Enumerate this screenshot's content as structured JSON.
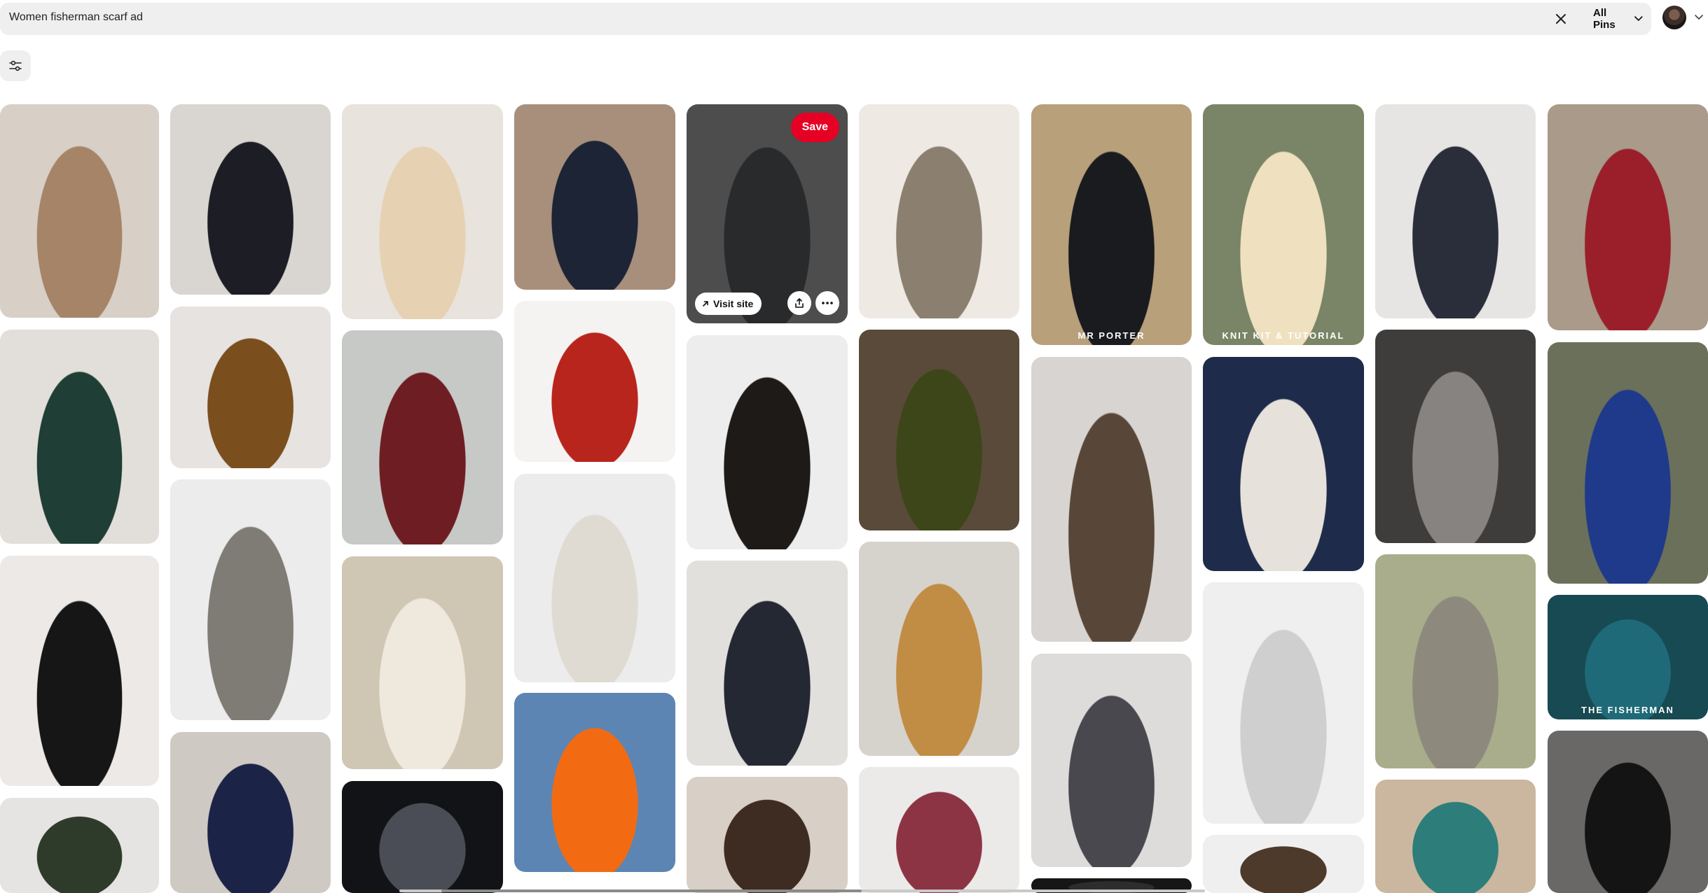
{
  "search": {
    "query": "Women fisherman scarf ad",
    "scope_label": "All Pins"
  },
  "pins": [
    {
      "id": "p01",
      "colors": [
        "#d8cfc6",
        "#a58468"
      ]
    },
    {
      "id": "p02",
      "colors": [
        "#d9d5d0",
        "#1d1e25"
      ]
    },
    {
      "id": "p03",
      "colors": [
        "#e8e3dc",
        "#e6d2b2"
      ]
    },
    {
      "id": "p04",
      "colors": [
        "#a78f7c",
        "#1c2435"
      ]
    },
    {
      "id": "p05",
      "colors": [
        "#6b6b6b",
        "#3a3b3d"
      ],
      "hovered": true
    },
    {
      "id": "p06",
      "colors": [
        "#eee9e3",
        "#8b7f70"
      ]
    },
    {
      "id": "p07",
      "colors": [
        "#b7a07a",
        "#1a1b1f"
      ],
      "caption": "MR PORTER"
    },
    {
      "id": "p08",
      "colors": [
        "#7a8466",
        "#efe1bf"
      ],
      "caption": "KNIT KIT & TUTORIAL"
    },
    {
      "id": "p09",
      "colors": [
        "#e7e5e3",
        "#2a2e3a"
      ]
    },
    {
      "id": "p10",
      "colors": [
        "#a99a8a",
        "#9a1f2a"
      ]
    },
    {
      "id": "p11",
      "colors": [
        "#e2dfda",
        "#1f3e35"
      ]
    },
    {
      "id": "p12",
      "colors": [
        "#e6e3e0",
        "#7b4e1e"
      ]
    },
    {
      "id": "p13",
      "colors": [
        "#c7c9c7",
        "#6e1e22"
      ]
    },
    {
      "id": "p14",
      "colors": [
        "#f5f3f1",
        "#b7251d"
      ]
    },
    {
      "id": "p15",
      "colors": [
        "#ededed",
        "#1d1a18"
      ]
    },
    {
      "id": "p16",
      "colors": [
        "#5a4a3a",
        "#3d4618"
      ]
    },
    {
      "id": "p17",
      "colors": [
        "#d7d4d1",
        "#584738"
      ]
    },
    {
      "id": "p18",
      "colors": [
        "#1f2b4a",
        "#e6e1da"
      ]
    },
    {
      "id": "p19",
      "colors": [
        "#3f3d3b",
        "#878380"
      ]
    },
    {
      "id": "p20",
      "colors": [
        "#6b705a",
        "#1f3a8a"
      ]
    },
    {
      "id": "p21",
      "colors": [
        "#ece9e6",
        "#161616"
      ]
    },
    {
      "id": "p22",
      "colors": [
        "#ececec",
        "#7f7b75"
      ]
    },
    {
      "id": "p23",
      "colors": [
        "#d0c6b4",
        "#efe8dc"
      ]
    },
    {
      "id": "p24",
      "colors": [
        "#ececec",
        "#e0dbd2"
      ]
    },
    {
      "id": "p25",
      "colors": [
        "#e2e0dd",
        "#232833"
      ]
    },
    {
      "id": "p26",
      "colors": [
        "#d6d3cc",
        "#c18c43"
      ]
    },
    {
      "id": "p27",
      "colors": [
        "#dedcda",
        "#48484e"
      ]
    },
    {
      "id": "p28",
      "colors": [
        "#efefef",
        "#cfcfcf"
      ]
    },
    {
      "id": "p29",
      "colors": [
        "#a9ad8b",
        "#8d8a7d"
      ]
    },
    {
      "id": "p30",
      "colors": [
        "#174a52",
        "#1f6a78"
      ],
      "caption": "THE FISHERMAN"
    },
    {
      "id": "p31",
      "colors": [
        "#e6e4e2",
        "#2f3b2a"
      ]
    },
    {
      "id": "p32",
      "colors": [
        "#cfc9c3",
        "#1b2347"
      ]
    },
    {
      "id": "p33",
      "colors": [
        "#121316",
        "#4a4d55"
      ]
    },
    {
      "id": "p34",
      "colors": [
        "#5c85b3",
        "#f26b12"
      ]
    },
    {
      "id": "p35",
      "colors": [
        "#d8d0c6",
        "#3e2b21"
      ]
    },
    {
      "id": "p36",
      "colors": [
        "#eceae8",
        "#8d3444"
      ]
    },
    {
      "id": "p37",
      "colors": [
        "#161616",
        "#2d2d2d"
      ]
    },
    {
      "id": "p38",
      "colors": [
        "#efefef",
        "#4d3a2b"
      ]
    },
    {
      "id": "p39",
      "colors": [
        "#cbb79f",
        "#2d7d7a"
      ]
    },
    {
      "id": "p40",
      "colors": [
        "#6a6866",
        "#141414"
      ]
    }
  ],
  "hover_actions": {
    "save_label": "Save",
    "visit_label": "Visit site"
  }
}
